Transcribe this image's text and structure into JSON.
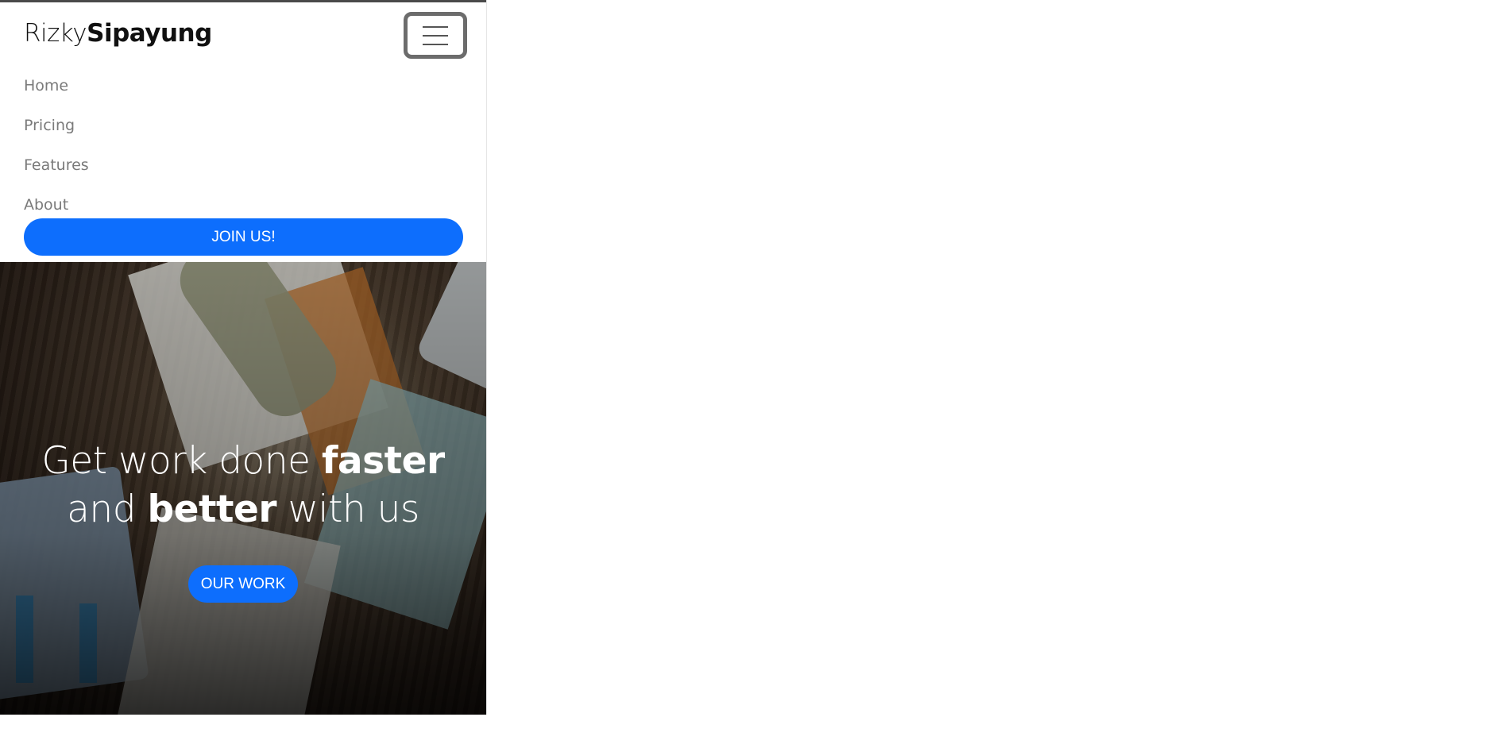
{
  "navbar": {
    "brand_light": "Rizky",
    "brand_bold": "Sipayung",
    "toggler_icon": "hamburger-icon",
    "links": [
      {
        "label": "Home"
      },
      {
        "label": "Pricing"
      },
      {
        "label": "Features"
      },
      {
        "label": "About"
      }
    ],
    "join_label": "JOIN US!"
  },
  "hero": {
    "title_part1": "Get work done ",
    "title_bold1": "faster",
    "title_part2": "and ",
    "title_bold2": "better",
    "title_part3": " with us",
    "cta_label": "OUR WORK"
  },
  "colors": {
    "accent": "#0d6efd",
    "nav_text": "#7a7a7a",
    "brand_text": "#111111"
  }
}
